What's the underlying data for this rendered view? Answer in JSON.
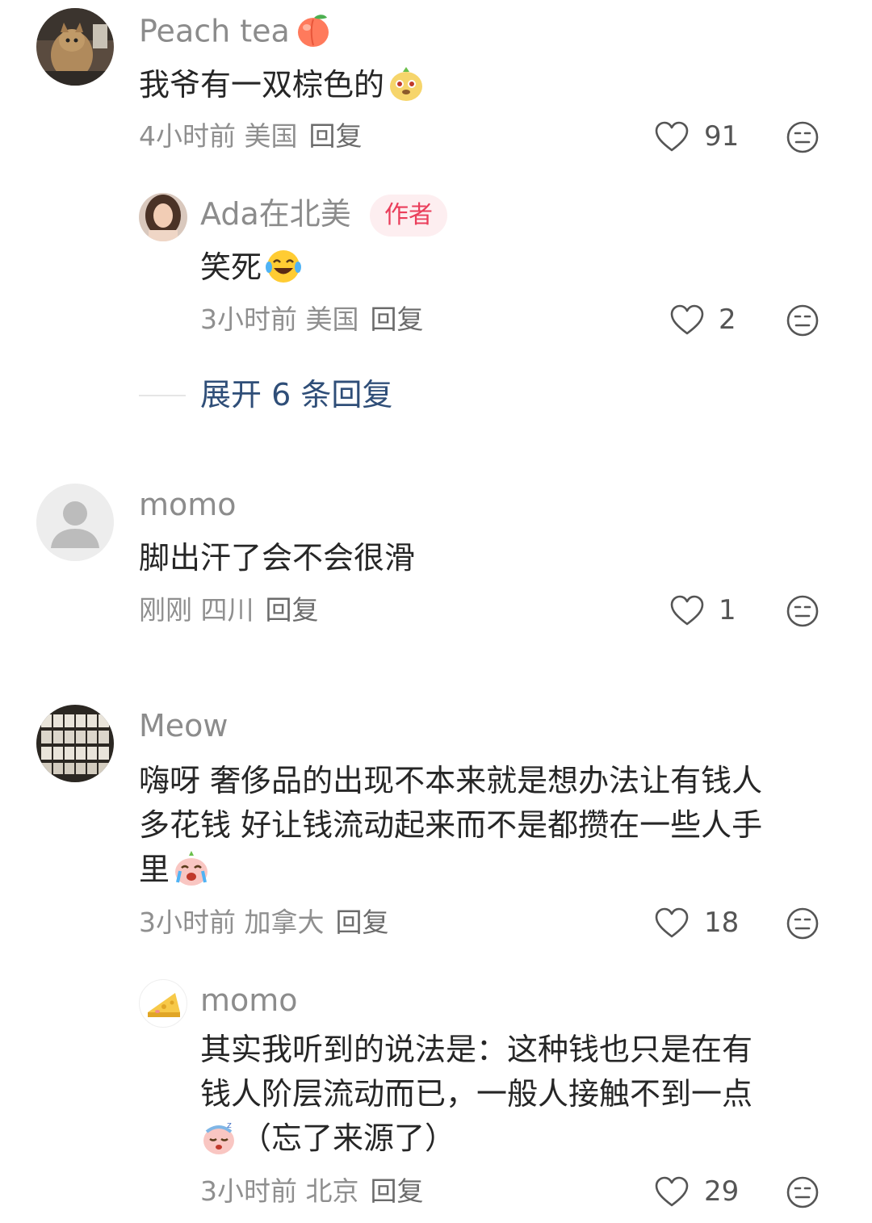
{
  "comments": [
    {
      "username": "Peach tea",
      "username_emoji": "peach-emoji",
      "text": "我爷有一双棕色的",
      "text_emoji": "dog-face-emoji",
      "time": "4小时前",
      "location": "美国",
      "reply_label": "回复",
      "likes": "91",
      "replies": [
        {
          "username": "Ada在北美",
          "badge": "作者",
          "text": "笑死",
          "text_emoji": "laughing-tears-emoji",
          "time": "3小时前",
          "location": "美国",
          "reply_label": "回复",
          "likes": "2"
        }
      ],
      "expand_label": "展开 6 条回复"
    },
    {
      "username": "momo",
      "text": "脚出汗了会不会很滑",
      "time": "刚刚",
      "location": "四川",
      "reply_label": "回复",
      "likes": "1"
    },
    {
      "username": "Meow",
      "text_lines": [
        "嗨呀 奢侈品的出现不本来就是想办法让有钱人",
        "多花钱 好让钱流动起来而不是都攒在一些人手",
        "里"
      ],
      "text_emoji": "crying-face-emoji",
      "time": "3小时前",
      "location": "加拿大",
      "reply_label": "回复",
      "likes": "18",
      "replies": [
        {
          "username": "momo",
          "text_lines": [
            "其实我听到的说法是：这种钱也只是在有",
            "钱人阶层流动而已，一般人接触不到一点",
            "（忘了来源了）"
          ],
          "text_emoji": "sleepy-face-emoji",
          "time": "3小时前",
          "location": "北京",
          "reply_label": "回复",
          "likes": "29"
        }
      ]
    }
  ],
  "colors": {
    "username": "#8c8c8c",
    "text": "#262626",
    "meta": "#8f8f8f",
    "badge_bg": "#fdeef0",
    "badge_text": "#ea3e5b",
    "expand_text": "#2f4e78"
  }
}
